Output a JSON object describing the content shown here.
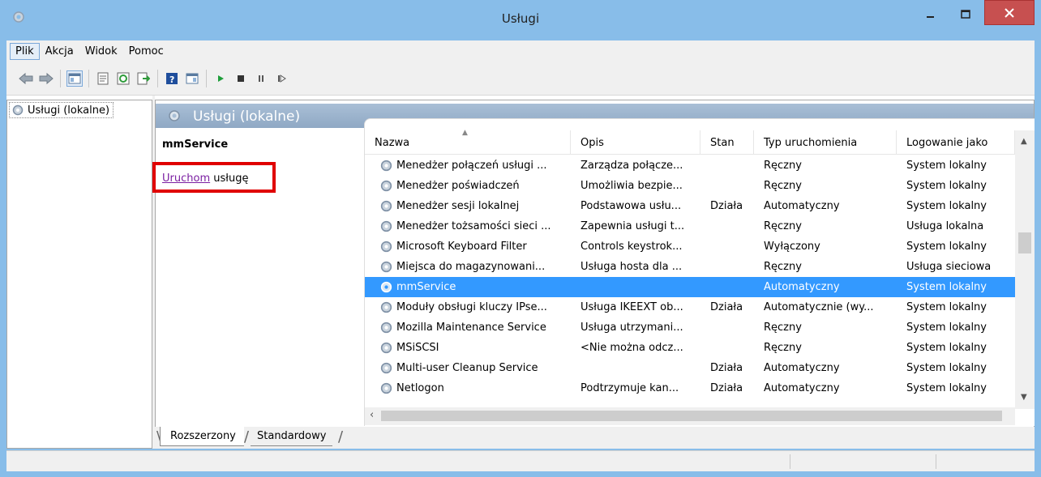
{
  "window": {
    "title": "Usługi"
  },
  "menu": {
    "items": [
      "Plik",
      "Akcja",
      "Widok",
      "Pomoc"
    ]
  },
  "toolbar": {
    "icons": [
      "back-arrow-icon",
      "forward-arrow-icon",
      "show-hide-console-tree-icon",
      "properties-icon",
      "refresh-icon",
      "export-list-icon",
      "help-icon",
      "action-pane-icon",
      "start-service-icon",
      "stop-service-icon",
      "pause-service-icon",
      "restart-service-icon"
    ]
  },
  "tree": {
    "root_label": "Usługi (lokalne)"
  },
  "main": {
    "header_title": "Usługi (lokalne)",
    "selected_service_name": "mmService",
    "start_link": "Uruchom",
    "start_suffix": " usługę"
  },
  "table": {
    "columns": [
      "Nazwa",
      "Opis",
      "Stan",
      "Typ uruchomienia",
      "Logowanie jako"
    ],
    "rows": [
      {
        "name": "Menedżer połączeń usługi ...",
        "opis": "Zarządza połącze...",
        "stan": "",
        "typ": "Ręczny",
        "log": "System lokalny",
        "selected": false
      },
      {
        "name": "Menedżer poświadczeń",
        "opis": "Umożliwia bezpie...",
        "stan": "",
        "typ": "Ręczny",
        "log": "System lokalny",
        "selected": false
      },
      {
        "name": "Menedżer sesji lokalnej",
        "opis": "Podstawowa usłu...",
        "stan": "Działa",
        "typ": "Automatyczny",
        "log": "System lokalny",
        "selected": false
      },
      {
        "name": "Menedżer tożsamości sieci ...",
        "opis": "Zapewnia usługi t...",
        "stan": "",
        "typ": "Ręczny",
        "log": "Usługa lokalna",
        "selected": false
      },
      {
        "name": "Microsoft Keyboard Filter",
        "opis": "Controls keystrok...",
        "stan": "",
        "typ": "Wyłączony",
        "log": "System lokalny",
        "selected": false
      },
      {
        "name": "Miejsca do magazynowani...",
        "opis": "Usługa hosta dla ...",
        "stan": "",
        "typ": "Ręczny",
        "log": "Usługa sieciowa",
        "selected": false
      },
      {
        "name": "mmService",
        "opis": "",
        "stan": "",
        "typ": "Automatyczny",
        "log": "System lokalny",
        "selected": true
      },
      {
        "name": "Moduły obsługi kluczy IPse...",
        "opis": "Usługa IKEEXT ob...",
        "stan": "Działa",
        "typ": "Automatycznie (wy...",
        "log": "System lokalny",
        "selected": false
      },
      {
        "name": "Mozilla Maintenance Service",
        "opis": "Usługa utrzymani...",
        "stan": "",
        "typ": "Ręczny",
        "log": "System lokalny",
        "selected": false
      },
      {
        "name": "MSiSCSI",
        "opis": "<Nie można odcz...",
        "stan": "",
        "typ": "Ręczny",
        "log": "System lokalny",
        "selected": false
      },
      {
        "name": "Multi-user Cleanup Service",
        "opis": "",
        "stan": "Działa",
        "typ": "Automatyczny",
        "log": "System lokalny",
        "selected": false
      },
      {
        "name": "Netlogon",
        "opis": "Podtrzymuje kan...",
        "stan": "Działa",
        "typ": "Automatyczny",
        "log": "System lokalny",
        "selected": false
      }
    ]
  },
  "tabs": {
    "extended": "Rozszerzony",
    "standard": "Standardowy"
  },
  "colors": {
    "selection": "#3399ff",
    "title_bg": "#88bde9",
    "close_btn": "#c75050",
    "highlight_box": "#e00000"
  }
}
